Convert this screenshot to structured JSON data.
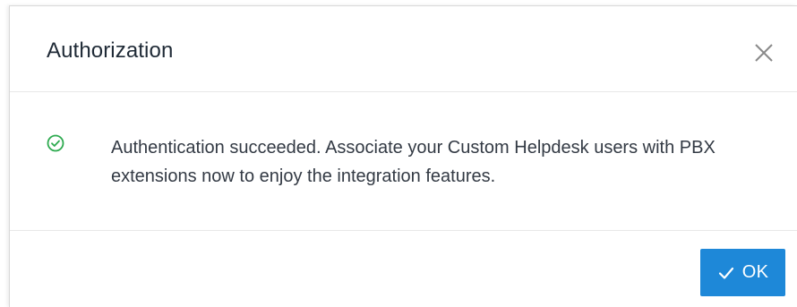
{
  "dialog": {
    "title": "Authorization",
    "close_icon": "close-icon",
    "status_icon": "success-check-circle-icon",
    "message": "Authentication succeeded. Associate your Custom Helpdesk users with PBX extensions now to enjoy the integration features.",
    "ok_label": "OK",
    "ok_icon": "checkmark-icon"
  },
  "colors": {
    "title": "#1f2a36",
    "message": "#333a44",
    "success": "#2daa4f",
    "primary": "#1e88d8",
    "close": "#8a8a8a",
    "divider": "#e8e8e8"
  }
}
